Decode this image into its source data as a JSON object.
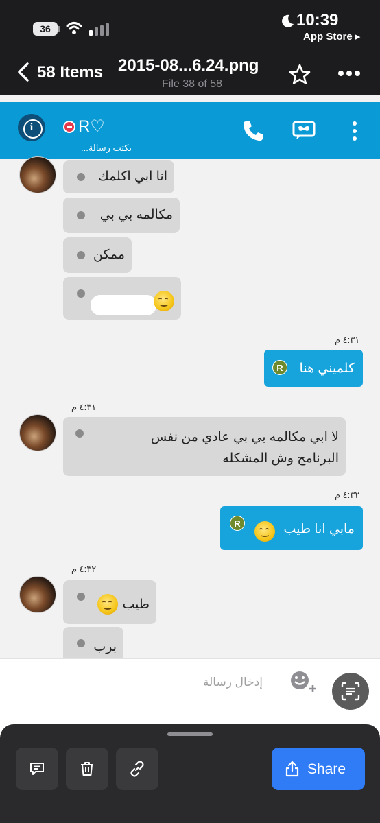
{
  "status_bar": {
    "battery": "36",
    "time": "10:39",
    "back_app": "App Store ▸"
  },
  "files_header": {
    "items_label": "58 Items",
    "title": "2015-08...6.24.png",
    "file_count": "File 38 of 58"
  },
  "chat": {
    "contact_name": "R♡",
    "typing": "يكتب رسالة...",
    "messages_in_top": [
      "انا ابي اكلمك",
      "مكالمه بي بي",
      "ممكن"
    ],
    "time_1": "٤:٣١ م",
    "out_1": "كلميني هنا",
    "time_2": "٤:٣١ م",
    "in_long_line1": "لا ابي مكالمه بي بي عادي من نفس",
    "in_long_line2": "البرنامج وش المشكله",
    "time_3": "٤:٣٢ م",
    "out_2": "مابي انا طيب",
    "time_4": "٤:٣٢ م",
    "in_3": "طيب",
    "in_4": "برب",
    "r_badge": "R",
    "input_placeholder": "إدخال رسالة"
  },
  "sheet": {
    "share_label": "Share"
  }
}
